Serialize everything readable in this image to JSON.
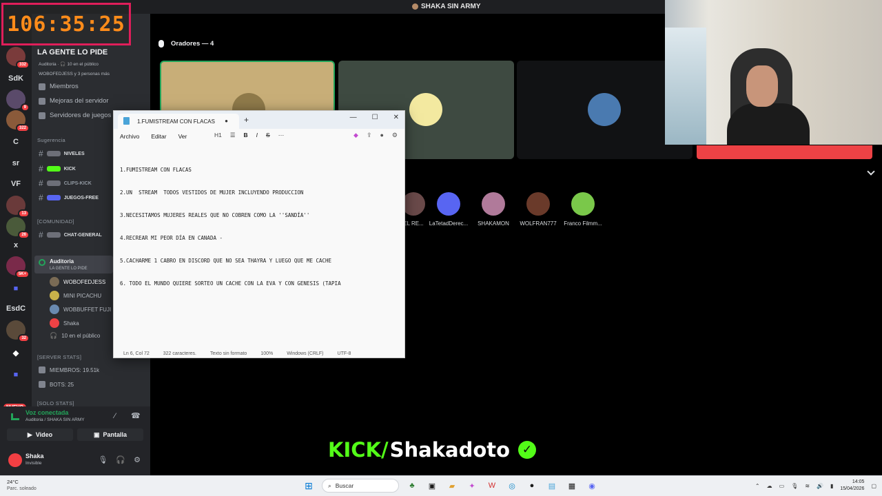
{
  "window": {
    "title": "SHAKA SIN ARMY"
  },
  "timer": "106:35:25",
  "rail": {
    "items": [
      "SdK",
      "C",
      "sr",
      "VF",
      "x",
      "EsdC"
    ],
    "badges": [
      "332",
      "9",
      "322",
      "13",
      "26",
      "5K+",
      "32"
    ],
    "new_label": "NUEVO"
  },
  "sidebar": {
    "server_name": "LA GENTE LO PIDE",
    "stage_info": "Auditoria · 🎧 10 en el público",
    "listeners": "WOBOFEDJESS y 3 personas más",
    "links": [
      "Miembros",
      "Mejoras del servidor",
      "Servidores de juegos"
    ],
    "cat_sugerencia": "Sugerencia",
    "channels_1": [
      "NIVELES",
      "KICK",
      "CLIPS-KICK",
      "JUEGOS-FREE"
    ],
    "cat_comunidad": "[COMUNIDAD]",
    "channels_2": [
      "CHAT-GENERAL"
    ],
    "voice_channel": {
      "name": "Auditoria",
      "sub": "LA GENTE LO PIDE"
    },
    "voice_users": [
      "WOBOFEDJESS",
      "MINI PICACHU",
      "WOBBUFFET FUJI",
      "Shaka",
      "10 en el público"
    ],
    "cat_stats": "[SERVER STATS]",
    "stats": [
      "MIEMBROS: 19.51k",
      "BOTS: 25"
    ],
    "cat_solo": "[SOLO STATS]"
  },
  "voice_panel": {
    "status": "Voz conectada",
    "channel": "Auditoria / SHAKA SIN ARMY",
    "video_label": "Video",
    "screen_label": "Pantalla"
  },
  "user": {
    "name": "Shaka",
    "status": "Invisible"
  },
  "stage": {
    "speakers_label": "Oradores — 4",
    "audience": [
      "EL RE...",
      "LaTetadDerec...",
      "SHAKAMON",
      "WOLFRAN777",
      "Franco Filmm..."
    ]
  },
  "notepad": {
    "tab_title": "1.FUMISTREAM CON FLACAS",
    "menu": [
      "Archivo",
      "Editar",
      "Ver"
    ],
    "heading_tool": "H1",
    "lines": [
      "1.FUMISTREAM CON FLACAS",
      "2.UN  STREAM  TODOS VESTIDOS DE MUJER INCLUYENDO PRODUCCION",
      "3.NECESITAMOS MUJERES REALES QUE NO COBREN COMO LA ''SANDÍA''",
      "4.RECREAR MI PEOR DÍA EN CANADA -",
      "5.CACHARME 1 CABRO EN DISCORD QUE NO SEA THAYRA Y LUEGO QUE ME CACHE",
      "6. TODO EL MUNDO QUIERE SORTEO UN CACHE CON LA EVA Y CON GENESIS (TAPIA"
    ],
    "status": [
      "Ln 6, Col 72",
      "322 caracteres.",
      "Texto sin formato",
      "100%",
      "Windows (CRLF)",
      "UTF-8"
    ]
  },
  "branding": {
    "kick": "KICK/",
    "name": "Shakadoto"
  },
  "taskbar": {
    "weather_temp": "24°C",
    "weather_desc": "Parc. soleado",
    "search_placeholder": "Buscar",
    "time": "14:05",
    "date": "15/04/2026"
  },
  "colors": {
    "accent_kick": "#53fc18",
    "discord_red": "#ed4245",
    "timer": "#ff8c1a",
    "voice_green": "#23a55a"
  }
}
